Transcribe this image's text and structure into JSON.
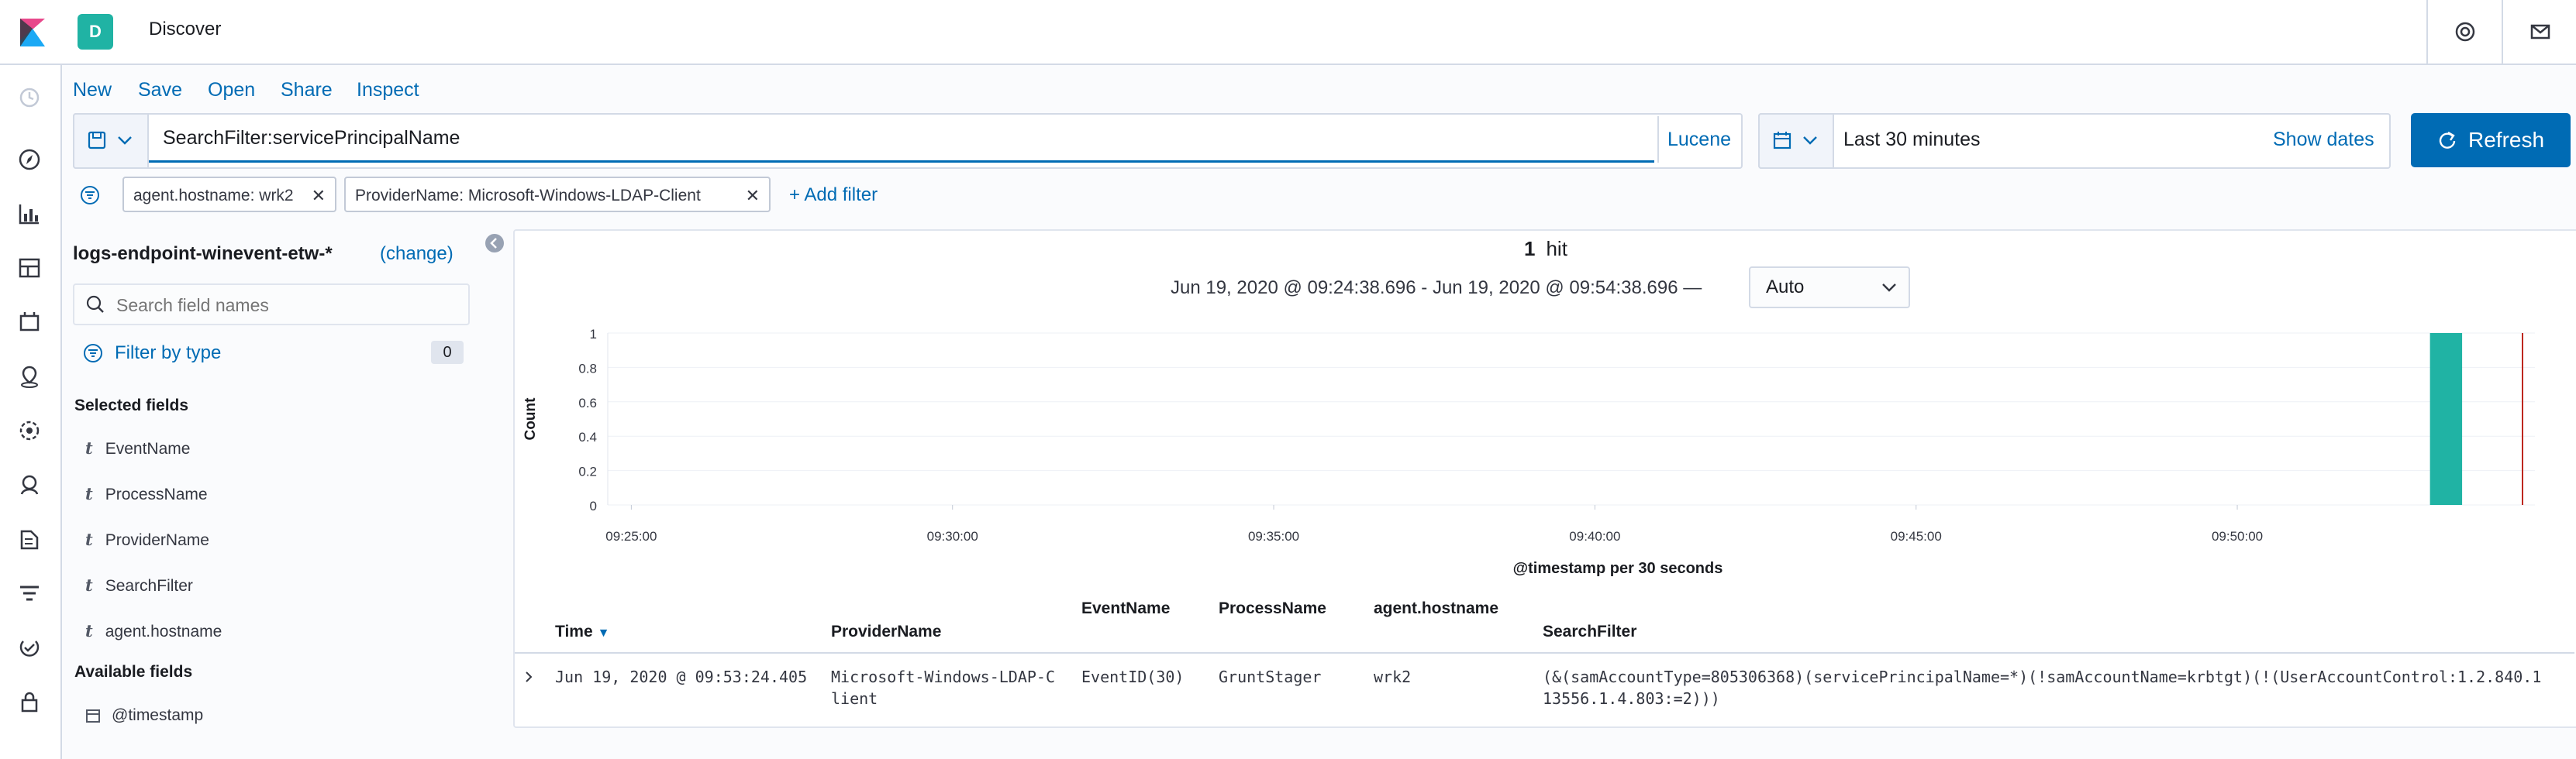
{
  "header": {
    "space_initial": "D",
    "app_title": "Discover",
    "icons": [
      "kibana-logo-icon",
      "help-icon",
      "mail-icon"
    ]
  },
  "nav_icons": [
    "clock-icon",
    "compass-icon",
    "visualize-icon",
    "dashboard-icon",
    "canvas-icon",
    "maps-icon",
    "ml-icon",
    "siem-icon",
    "logs-icon",
    "apm-icon",
    "uptime-icon",
    "security-icon"
  ],
  "menu": {
    "new": "New",
    "save": "Save",
    "open": "Open",
    "share": "Share",
    "inspect": "Inspect"
  },
  "query": {
    "value": "SearchFilter:servicePrincipalName",
    "language": "Lucene"
  },
  "time_picker": {
    "label": "Last 30 minutes",
    "show_dates": "Show dates",
    "refresh": "Refresh"
  },
  "filters": [
    {
      "label": "agent.hostname: wrk2"
    },
    {
      "label": "ProviderName: Microsoft-Windows-LDAP-Client"
    }
  ],
  "add_filter": "+ Add filter",
  "sidebar": {
    "index_pattern": "logs-endpoint-winevent-etw-*",
    "change": "(change)",
    "search_placeholder": "Search field names",
    "filter_by_type": "Filter by type",
    "filter_count": "0",
    "selected_heading": "Selected fields",
    "selected_fields": [
      {
        "type": "t",
        "name": "EventName"
      },
      {
        "type": "t",
        "name": "ProcessName"
      },
      {
        "type": "t",
        "name": "ProviderName"
      },
      {
        "type": "t",
        "name": "SearchFilter"
      },
      {
        "type": "t",
        "name": "agent.hostname"
      }
    ],
    "available_heading": "Available fields",
    "available_fields": [
      {
        "type": "date",
        "name": "@timestamp"
      }
    ]
  },
  "results": {
    "hit_count": "1",
    "hit_label": "hit",
    "time_range": "Jun 19, 2020 @ 09:24:38.696 - Jun 19, 2020 @ 09:54:38.696 —",
    "interval": "Auto"
  },
  "chart_data": {
    "type": "bar",
    "ylabel": "Count",
    "xlabel": "@timestamp per 30 seconds",
    "y_ticks": [
      "1",
      "0.8",
      "0.6",
      "0.4",
      "0.2",
      "0"
    ],
    "x_ticks": [
      "09:25:00",
      "09:30:00",
      "09:35:00",
      "09:40:00",
      "09:45:00",
      "09:50:00"
    ],
    "ylim": [
      0,
      1
    ],
    "xlim": [
      "09:24:38",
      "09:54:38"
    ],
    "bars": [
      {
        "x": "09:53:00",
        "value": 1
      }
    ],
    "bar_color": "#20b3a4",
    "now_marker": "09:54:38",
    "now_marker_color": "#bd271e"
  },
  "table": {
    "columns": [
      "Time",
      "ProviderName",
      "EventName",
      "ProcessName",
      "agent.hostname",
      "SearchFilter"
    ],
    "rows": [
      {
        "time": "Jun 19, 2020 @ 09:53:24.405",
        "provider_line1": "Microsoft-Windows-LDAP-C",
        "provider_line2": "lient",
        "event_name": "EventID(30)",
        "process_name": "GruntStager",
        "hostname": "wrk2",
        "search_filter_line1": "(&(samAccountType=805306368)(servicePrincipalName=*)(!samAccountName=krbtgt)(!(UserAccountControl:1.2.840.1",
        "search_filter_line2": "13556.1.4.803:=2)))"
      }
    ]
  }
}
